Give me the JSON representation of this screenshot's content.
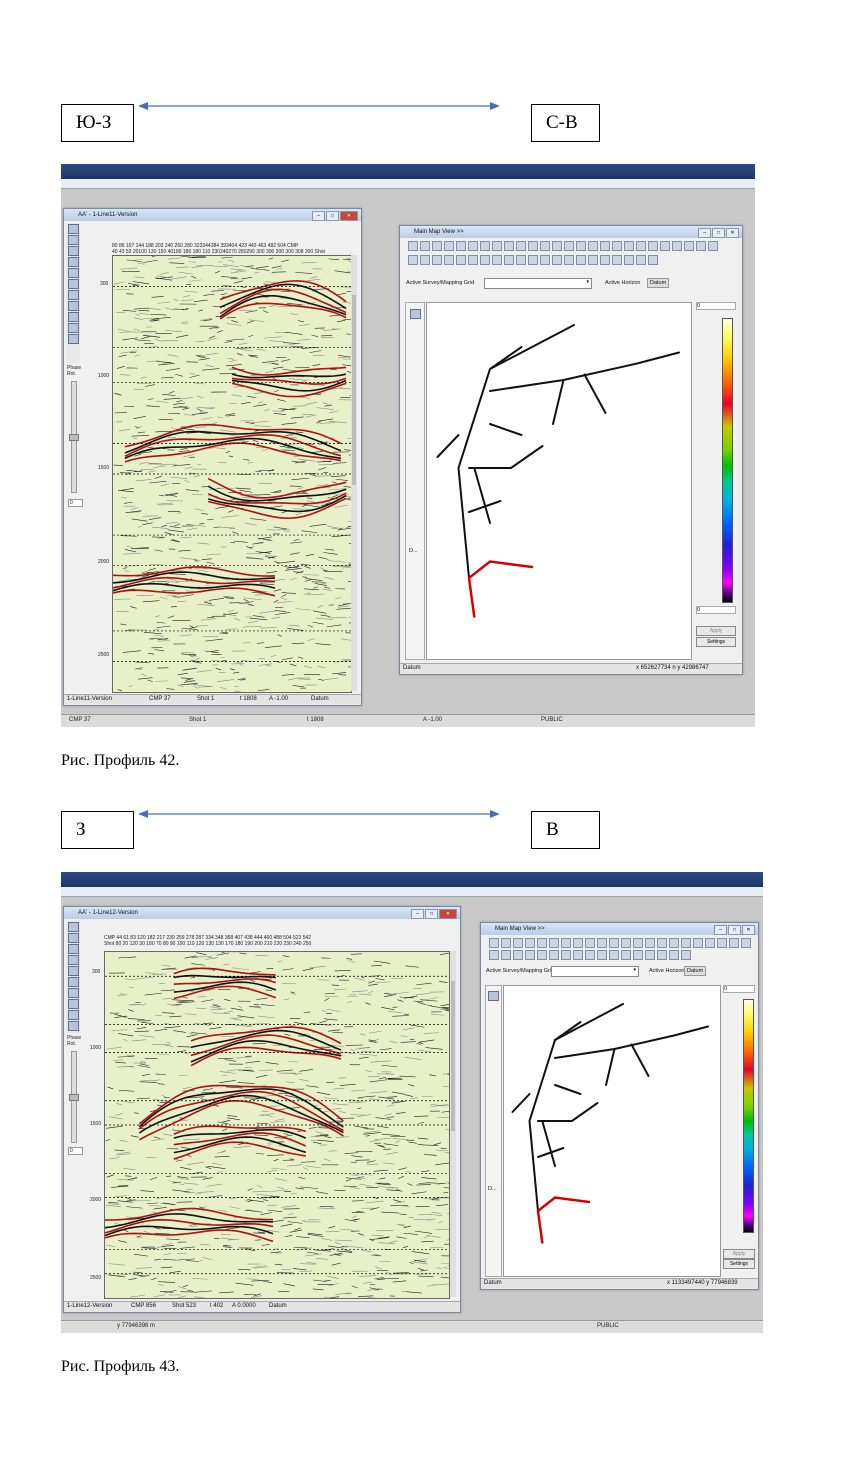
{
  "figures": [
    {
      "left_label": "Ю-З",
      "right_label": "С-В",
      "caption": "Рис. Профиль 42.",
      "profile_window": {
        "title": "AA' - 1-Line11-Version",
        "phase_label": "Phase Rot.",
        "phase_value": "0",
        "time_ticks": [
          "300",
          "1000",
          "1500",
          "2000",
          "2500"
        ],
        "cmp_row": "80  86 107   144 188   203  240 260 280   323344384 393404 423 443 463 482 504  CMP",
        "shot_row": "40  43  53  20100 130 150   40180 180  180 110   230240270 280290 300 300 300 300 308 300  Shot",
        "status": {
          "name": "1-Line11-Version",
          "cmp": "CMP 37",
          "shot": "Shot 1",
          "t": "t 1808",
          "a": "A -1.00",
          "datum": "Datum"
        }
      },
      "map_window": {
        "title": "Main Map View >>",
        "survey_label": "Active Survey/Mapping Grid",
        "horizon_label": "Active Horizon",
        "horizon_value": "Datum",
        "colorbar_top": "0",
        "colorbar_bottom": "0",
        "apply": "Apply",
        "settings": "Settings",
        "side_label": "D...",
        "status_left": "Datum",
        "coords": "x 652627734  n  y 42986747"
      },
      "bottom_status": {
        "cmp": "CMP 37",
        "shot": "Shot 1",
        "t": "t 1808",
        "a": "A -1.00",
        "public": "PUBLIC"
      }
    },
    {
      "left_label": "З",
      "right_label": "В",
      "caption": "Рис. Профиль 43.",
      "profile_window": {
        "title": "AA' - 1-Line12-Version",
        "phase_label": "Phase Rot.",
        "phase_value": "0",
        "time_ticks": [
          "300",
          "1000",
          "1500",
          "2000",
          "2500"
        ],
        "cmp_row": "CMP 44 61   83 120   182   217 239 259 278 287   334   348 368 407 438 444 460 488 504 523 542",
        "shot_row": "Shot  80 20  120 30 180   70 80 90 100 110 120 130   130   170 180 190 200 210 220 230 240 250",
        "status": {
          "name": "1-Line12-Version",
          "cmp": "CMP 856",
          "shot": "Shot 523",
          "t": "t 402",
          "a": "A 0.0000",
          "datum": "Datum"
        }
      },
      "map_window": {
        "title": "Main Map View >>",
        "survey_label": "Active Survey/Mapping Grid",
        "horizon_label": "Active Horizon",
        "horizon_value": "Datum",
        "colorbar_top": "0",
        "colorbar_bottom": "",
        "apply": "Apply",
        "settings": "Settings",
        "side_label": "D...",
        "status_left": "Datum",
        "coords": "x 1133497440    y 77946839"
      },
      "bottom_status": {
        "coord": "y 77946398 m",
        "public": "PUBLIC"
      }
    }
  ],
  "colors": {
    "titlebar": "#2d4d86",
    "seis_bg": "#e8f0c8",
    "seis_red": "#b01010",
    "arrow": "#4a6fb0"
  }
}
